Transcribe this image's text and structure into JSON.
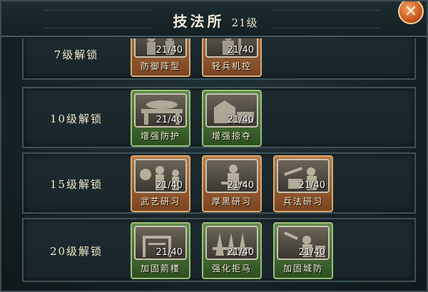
{
  "window": {
    "title": "技法所",
    "level": "21级",
    "close_icon": "close-icon"
  },
  "rows": [
    {
      "label": "7级解锁",
      "cards": [
        {
          "name": "防御阵型",
          "count": "21/40",
          "style": "bronze"
        },
        {
          "name": "轻兵机控",
          "count": "21/40",
          "style": "bronze"
        }
      ]
    },
    {
      "label": "10级解锁",
      "cards": [
        {
          "name": "增强防护",
          "count": "21/40",
          "style": "green"
        },
        {
          "name": "增强掠夺",
          "count": "21/40",
          "style": "green"
        }
      ]
    },
    {
      "label": "15级解锁",
      "cards": [
        {
          "name": "武艺研习",
          "count": "21/40",
          "style": "bronze"
        },
        {
          "name": "厚黑研习",
          "count": "21/40",
          "style": "bronze"
        },
        {
          "name": "兵法研习",
          "count": "21/40",
          "style": "bronze"
        }
      ]
    },
    {
      "label": "20级解锁",
      "cards": [
        {
          "name": "加固箭楼",
          "count": "21/40",
          "style": "green"
        },
        {
          "name": "强化拒马",
          "count": "21/40",
          "style": "green"
        },
        {
          "name": "加固城防",
          "count": "21/40",
          "style": "green"
        }
      ]
    }
  ],
  "colors": {
    "bronze_card": "#9a5e30",
    "green_card": "#4a7438",
    "close_button": "#d8702c",
    "title_text": "#f2ecd8"
  }
}
